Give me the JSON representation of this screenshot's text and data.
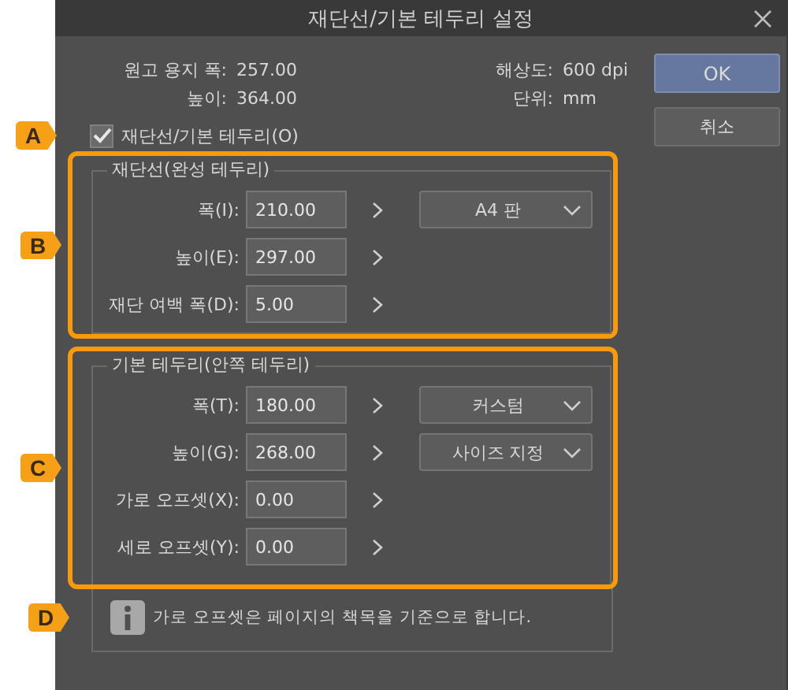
{
  "window": {
    "title": "재단선/기본 테두리 설정"
  },
  "info": [
    {
      "label": "원고 용지 폭:",
      "value": "257.00"
    },
    {
      "label": "해상도:",
      "value": "600 dpi"
    },
    {
      "label": "높이:",
      "value": "364.00"
    },
    {
      "label": "단위:",
      "value": "mm"
    }
  ],
  "checkbox": {
    "label": "재단선/기본 테두리(O)",
    "checked": true,
    "callout": "A"
  },
  "sections": [
    {
      "legend": "재단선(완성 테두리)",
      "callout": "B",
      "fields": [
        {
          "label": "폭(I):",
          "value": "210.00",
          "dropdown": "A4 판"
        },
        {
          "label": "높이(E):",
          "value": "297.00"
        },
        {
          "label": "재단 여백 폭(D):",
          "value": "5.00"
        }
      ]
    },
    {
      "legend": "기본 테두리(안쪽 테두리)",
      "callout": "C",
      "fields": [
        {
          "label": "폭(T):",
          "value": "180.00",
          "dropdown": "커스텀"
        },
        {
          "label": "높이(G):",
          "value": "268.00",
          "dropdown": "사이즈 지정"
        },
        {
          "label": "가로 오프셋(X):",
          "value": "0.00"
        },
        {
          "label": "세로 오프셋(Y):",
          "value": "0.00"
        }
      ]
    }
  ],
  "note": {
    "text": "가로 오프셋은 페이지의 책목을 기준으로 합니다.",
    "callout": "D"
  },
  "buttons": [
    {
      "label": "OK",
      "default": true
    },
    {
      "label": "취소",
      "default": false
    }
  ]
}
